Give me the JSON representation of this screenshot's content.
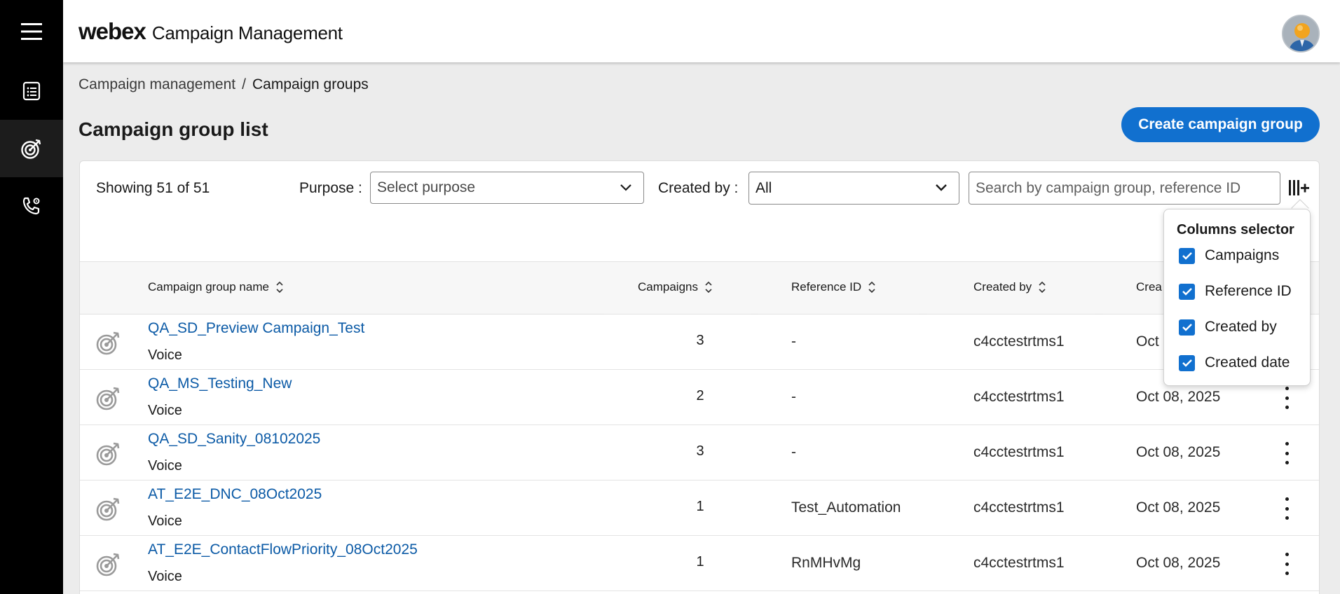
{
  "rail": {
    "items": [
      {
        "icon": "list-icon",
        "active": false
      },
      {
        "icon": "target-icon",
        "active": true
      },
      {
        "icon": "phone-settings-icon",
        "active": false
      }
    ]
  },
  "header": {
    "logo": "webex",
    "title": "Campaign Management"
  },
  "breadcrumb": {
    "parent": "Campaign management",
    "separator": "/",
    "current": "Campaign groups"
  },
  "page": {
    "title": "Campaign group list",
    "create_button": "Create campaign group"
  },
  "toolbar": {
    "showing": "Showing 51 of 51",
    "purpose_label": "Purpose :",
    "purpose_placeholder": "Select purpose",
    "created_by_label": "Created by :",
    "created_by_value": "All",
    "search_placeholder": "Search by campaign group, reference ID"
  },
  "table": {
    "columns": {
      "name": "Campaign group name",
      "campaigns": "Campaigns",
      "reference": "Reference ID",
      "created_by": "Created by",
      "created_date": "Crea"
    },
    "rows": [
      {
        "name": "QA_SD_Preview Campaign_Test",
        "purpose": "Voice",
        "campaigns": "3",
        "reference": "-",
        "created_by": "c4cctestrtms1",
        "date": "Oct"
      },
      {
        "name": "QA_MS_Testing_New",
        "purpose": "Voice",
        "campaigns": "2",
        "reference": "-",
        "created_by": "c4cctestrtms1",
        "date": "Oct 08, 2025"
      },
      {
        "name": "QA_SD_Sanity_08102025",
        "purpose": "Voice",
        "campaigns": "3",
        "reference": "-",
        "created_by": "c4cctestrtms1",
        "date": "Oct 08, 2025"
      },
      {
        "name": "AT_E2E_DNC_08Oct2025",
        "purpose": "Voice",
        "campaigns": "1",
        "reference": "Test_Automation",
        "created_by": "c4cctestrtms1",
        "date": "Oct 08, 2025"
      },
      {
        "name": "AT_E2E_ContactFlowPriority_08Oct2025",
        "purpose": "Voice",
        "campaigns": "1",
        "reference": "RnMHvMg",
        "created_by": "c4cctestrtms1",
        "date": "Oct 08, 2025"
      }
    ]
  },
  "columns_selector": {
    "title": "Columns selector",
    "options": [
      {
        "label": "Campaigns",
        "checked": true
      },
      {
        "label": "Reference ID",
        "checked": true
      },
      {
        "label": "Created by",
        "checked": true
      },
      {
        "label": "Created date",
        "checked": true
      }
    ]
  },
  "colors": {
    "accent": "#1170cf",
    "link": "#0b5aa6",
    "rail": "#000000"
  }
}
